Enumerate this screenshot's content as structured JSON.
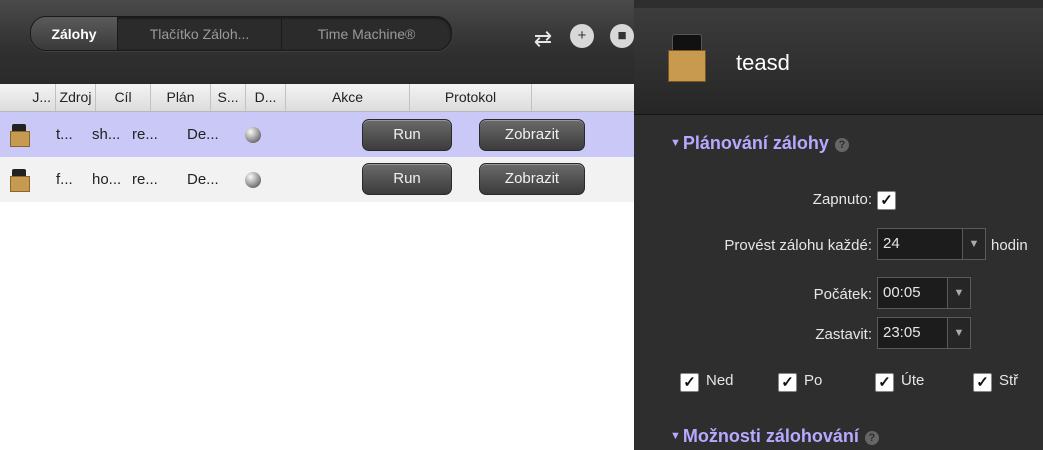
{
  "tabs": [
    {
      "label": "Zálohy",
      "active": true
    },
    {
      "label": "Tlačítko Záloh...",
      "active": false
    },
    {
      "label": "Time Machine®",
      "active": false
    }
  ],
  "toolbar_icons": [
    "refresh-icon",
    "add-package-icon",
    "package-icon"
  ],
  "table": {
    "columns": [
      "J...",
      "Zdroj",
      "Cíl",
      "Plán",
      "S...",
      "D...",
      "Akce",
      "Protokol"
    ],
    "rows": [
      {
        "name": "t...",
        "source": "sh...",
        "target": "re...",
        "plan": "De...",
        "action": "Run",
        "log": "Zobrazit",
        "selected": true
      },
      {
        "name": "f...",
        "source": "ho...",
        "target": "re...",
        "plan": "De...",
        "action": "Run",
        "log": "Zobrazit",
        "selected": false
      }
    ]
  },
  "panel": {
    "title": "teasd",
    "schedule_section": "Plánování zálohy",
    "enabled_label": "Zapnuto:",
    "enabled": true,
    "every_label": "Provést zálohu každé:",
    "every_value": "24",
    "every_unit": "hodin",
    "start_label": "Počátek:",
    "start_value": "00:05",
    "stop_label": "Zastavit:",
    "stop_value": "23:05",
    "days": [
      {
        "label": "Ned",
        "checked": true
      },
      {
        "label": "Po",
        "checked": true
      },
      {
        "label": "Úte",
        "checked": true
      },
      {
        "label": "Stř",
        "checked": true
      }
    ],
    "options_section": "Možnosti zálohování",
    "help_glyph": "?"
  },
  "colors": {
    "selected_row": "#c9c8f6",
    "section_heading": "#b8a8ff",
    "panel_bg": "#2e2e2e"
  }
}
